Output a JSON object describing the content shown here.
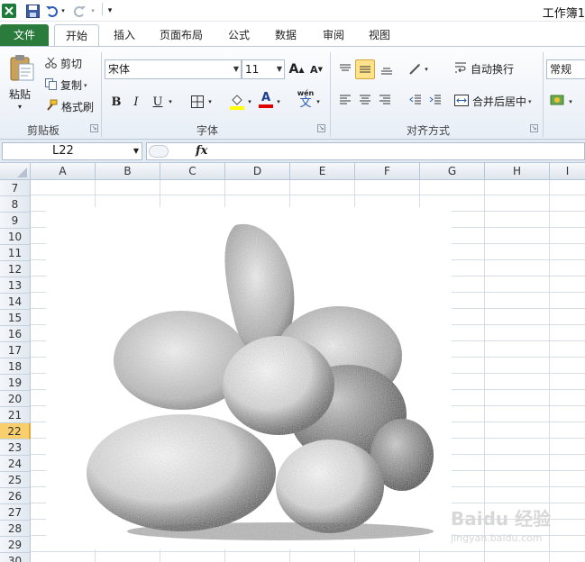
{
  "title_bar": {
    "document_title": "工作簿1",
    "quick_access": [
      "excel-logo-icon",
      "save-icon",
      "undo-icon",
      "redo-icon",
      "customize-icon"
    ]
  },
  "tabs": [
    {
      "label": "文件",
      "active": false
    },
    {
      "label": "开始",
      "active": true
    },
    {
      "label": "插入",
      "active": false
    },
    {
      "label": "页面布局",
      "active": false
    },
    {
      "label": "公式",
      "active": false
    },
    {
      "label": "数据",
      "active": false
    },
    {
      "label": "审阅",
      "active": false
    },
    {
      "label": "视图",
      "active": false
    }
  ],
  "ribbon": {
    "clipboard": {
      "label": "剪贴板",
      "paste": "粘贴",
      "cut": "剪切",
      "copy": "复制",
      "format_painter": "格式刷"
    },
    "font": {
      "label": "字体",
      "font_name": "宋体",
      "font_size": "11",
      "bold": "B",
      "italic": "I",
      "underline": "U",
      "grow": "A",
      "shrink": "A",
      "font_color_letter": "A",
      "phonetic": "wén",
      "phonetic_char": "文",
      "fill_color": "#ffff00",
      "font_color": "#e00000"
    },
    "alignment": {
      "label": "对齐方式",
      "wrap_text": "自动换行",
      "merge_center": "合并后居中"
    },
    "number": {
      "format": "常规"
    }
  },
  "formula_bar": {
    "name_box": "L22",
    "fx": "fx",
    "formula": ""
  },
  "grid": {
    "columns": [
      "A",
      "B",
      "C",
      "D",
      "E",
      "F",
      "G",
      "H",
      "I"
    ],
    "rows": [
      "7",
      "8",
      "9",
      "10",
      "11",
      "12",
      "13",
      "14",
      "15",
      "16",
      "17",
      "18",
      "19",
      "20",
      "21",
      "22",
      "23",
      "24",
      "25",
      "26",
      "27",
      "28",
      "29",
      "30"
    ],
    "selected_row": "22"
  },
  "watermark": {
    "text": "Baidu 经验",
    "sub": "jingyan.baidu.com"
  }
}
